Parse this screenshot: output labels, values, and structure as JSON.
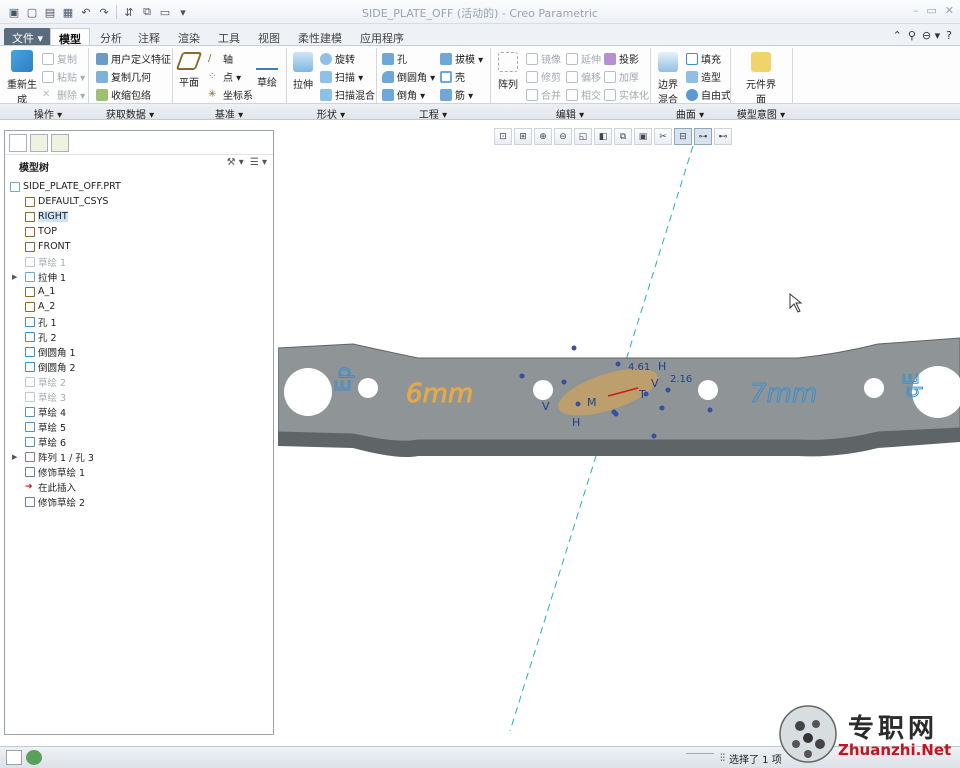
{
  "window": {
    "title": "SIDE_PLATE_OFF (活动的) - Creo Parametric",
    "controls": [
      "–",
      "▭",
      "✕"
    ]
  },
  "tabs": [
    {
      "label": "文件 ▾",
      "key": "file"
    },
    {
      "label": "模型",
      "key": "model"
    },
    {
      "label": "分析",
      "key": "analysis"
    },
    {
      "label": "注释",
      "key": "annotate"
    },
    {
      "label": "渲染",
      "key": "render"
    },
    {
      "label": "工具",
      "key": "tools"
    },
    {
      "label": "视图",
      "key": "view"
    },
    {
      "label": "柔性建模",
      "key": "flex"
    },
    {
      "label": "应用程序",
      "key": "apps"
    }
  ],
  "tabbar_right": [
    "⌃",
    "⚲",
    "⊖ ▾",
    "?"
  ],
  "ribbon": {
    "regenerate": "重新生成",
    "copy": "复制",
    "paste": "粘贴 ▾",
    "delete": "删除 ▾",
    "udf": "用户定义特征",
    "copy_geom": "复制几何",
    "shrinkwrap": "收缩包络",
    "plane": "平面",
    "axis": "轴",
    "point": "点 ▾",
    "csys": "坐标系",
    "sketch": "草绘",
    "extrude": "拉伸",
    "revolve": "旋转",
    "sweep": "扫描 ▾",
    "swept_blend": "扫描混合",
    "hole": "孔",
    "round": "倒圆角 ▾",
    "chamfer": "倒角 ▾",
    "draft": "拔模 ▾",
    "shell": "壳",
    "rib": "筋 ▾",
    "pattern": "阵列",
    "mirror": "镜像",
    "trim": "修剪",
    "merge": "合并",
    "extend": "延伸",
    "offset": "偏移",
    "intersect": "相交",
    "project": "投影",
    "thicken": "加厚",
    "solidify": "实体化",
    "boundary_blend": "边界混合",
    "fill": "填充",
    "style": "造型",
    "freestyle": "自由式",
    "component_interface": "元件界面"
  },
  "groups": [
    "操作 ▾",
    "获取数据 ▾",
    "基准 ▾",
    "形状 ▾",
    "工程 ▾",
    "编辑 ▾",
    "曲面 ▾",
    "模型意图 ▾"
  ],
  "tree": {
    "header": "模型树",
    "items": [
      {
        "label": "SIDE_PLATE_OFF.PRT",
        "type": "part",
        "top": true
      },
      {
        "label": "DEFAULT_CSYS",
        "type": "csys"
      },
      {
        "label": "RIGHT",
        "type": "plane",
        "selected": true
      },
      {
        "label": "TOP",
        "type": "plane"
      },
      {
        "label": "FRONT",
        "type": "plane"
      },
      {
        "label": "草绘 1",
        "type": "sketch",
        "suppressed": true
      },
      {
        "label": "拉伸 1",
        "type": "extrude",
        "expandable": true
      },
      {
        "label": "A_1",
        "type": "axis"
      },
      {
        "label": "A_2",
        "type": "axis"
      },
      {
        "label": "孔 1",
        "type": "hole"
      },
      {
        "label": "孔 2",
        "type": "hole"
      },
      {
        "label": "倒圆角 1",
        "type": "round"
      },
      {
        "label": "倒圆角 2",
        "type": "round"
      },
      {
        "label": "草绘 2",
        "type": "sketch",
        "suppressed": true
      },
      {
        "label": "草绘 3",
        "type": "sketch",
        "suppressed": true
      },
      {
        "label": "草绘 4",
        "type": "sketch"
      },
      {
        "label": "草绘 5",
        "type": "sketch"
      },
      {
        "label": "草绘 6",
        "type": "sketch"
      },
      {
        "label": "阵列 1 / 孔 3",
        "type": "pattern",
        "expandable": true
      },
      {
        "label": "修饰草绘 1",
        "type": "cosmetic"
      },
      {
        "label": "在此插入",
        "type": "insert"
      },
      {
        "label": "修饰草绘 2",
        "type": "cosmetic"
      }
    ]
  },
  "viewport": {
    "text_left": "6mm",
    "text_right": "7mm",
    "dim_1": "4.61",
    "dim_2": "2.16",
    "label_h": "H",
    "label_v": "V",
    "label_m": "M",
    "label_t": "T"
  },
  "status": {
    "selection": "选择了 1 项"
  },
  "watermark": {
    "cn": "专职网",
    "en": "Zhuanzhi.Net"
  },
  "colors": {
    "part": "#8f9496",
    "part_dark": "#5f6466",
    "cosmetic_text": "#3b8fd0",
    "highlight": "#e2a84a",
    "axis": "#2aaec0"
  }
}
